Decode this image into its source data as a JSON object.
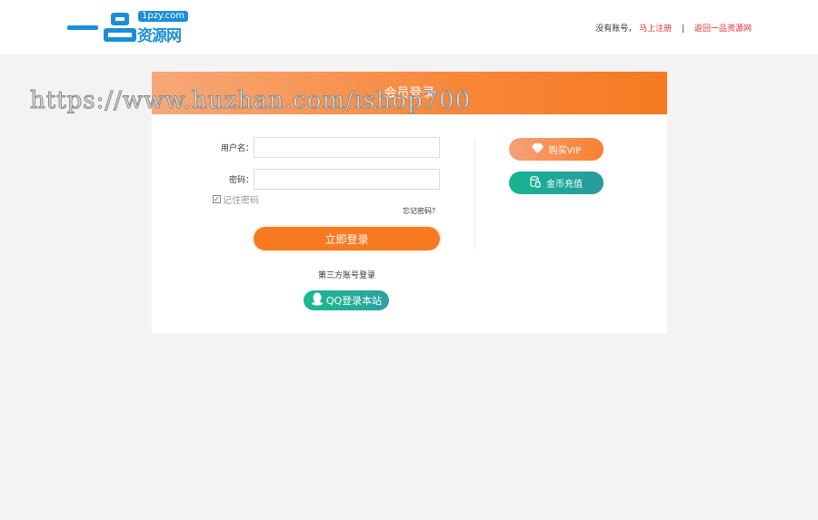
{
  "header": {
    "logo_domain": "1pzy.com",
    "logo_text": "资源网",
    "no_account": "没有账号，",
    "register": "马上注册",
    "separator": "|",
    "back_home": "返回一品资源网"
  },
  "card": {
    "title": "会员登录",
    "username_label": "用户名：",
    "password_label": "密码：",
    "username_value": "",
    "password_value": "",
    "remember": "记住密码",
    "forgot": "忘记密码？",
    "login": "立即登录",
    "third_party": "第三方账号登录",
    "qq_login": "QQ登录本站",
    "buy_vip": "购买VIP",
    "recharge": "金币充值"
  },
  "watermark": "https://www.huzhan.com/ishop700"
}
